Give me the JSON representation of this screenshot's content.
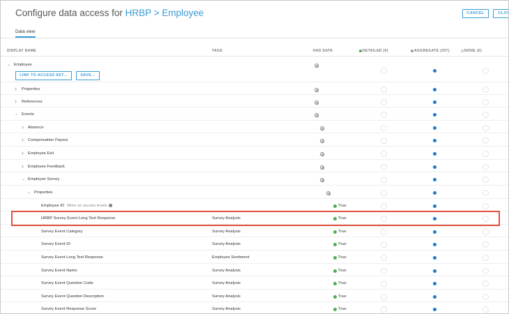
{
  "header": {
    "title_prefix": "Configure data access for ",
    "title_link": "HRBP > Employee",
    "cancel": "CANCEL",
    "close": "CLOSE"
  },
  "tabs": {
    "data_view": "Data view"
  },
  "columns": {
    "display_name": "DISPLAY NAME",
    "tags": "TAGS",
    "has_data": "HAS DATA",
    "detailed": "DETAILED (0)",
    "aggregate": "AGGREGATE (307)",
    "none": "NONE (0)"
  },
  "colors": {
    "accent": "#3a9bd5",
    "selected": "#1f7ac9",
    "true_dot": "#4caf50",
    "highlight": "#e0503c",
    "detailed_dot": "#4caf50",
    "aggregate_dot": "#9e9e9e",
    "none_dot": "#bbbbbb"
  },
  "buttons": {
    "link_to_access_set": "LINK TO ACCESS SET...",
    "save": "SAVE..."
  },
  "rows": [
    {
      "label": "Employee",
      "tag": "",
      "has": "icon",
      "chevron": "down",
      "selected": "aggregate"
    },
    {
      "label": "Properties",
      "tag": "",
      "has": "icon",
      "chevron": "right",
      "selected": "aggregate"
    },
    {
      "label": "References",
      "tag": "",
      "has": "icon",
      "chevron": "right",
      "selected": "aggregate"
    },
    {
      "label": "Events",
      "tag": "",
      "has": "icon",
      "chevron": "down",
      "selected": "aggregate"
    },
    {
      "label": "Absence",
      "tag": "",
      "has": "icon",
      "chevron": "right",
      "selected": "aggregate"
    },
    {
      "label": "Compensation Payout",
      "tag": "",
      "has": "icon",
      "chevron": "right",
      "selected": "aggregate"
    },
    {
      "label": "Employee Exit",
      "tag": "",
      "has": "icon",
      "chevron": "right",
      "selected": "aggregate"
    },
    {
      "label": "Employee Feedback",
      "tag": "",
      "has": "icon",
      "chevron": "right",
      "selected": "aggregate"
    },
    {
      "label": "Employee Survey",
      "tag": "",
      "has": "icon",
      "chevron": "down",
      "selected": "aggregate"
    },
    {
      "label": "Properties",
      "tag": "",
      "has": "icon",
      "chevron": "down",
      "selected": "aggregate"
    },
    {
      "label": "Employee ID",
      "note": "More on access levels",
      "tag": "",
      "has": "True",
      "selected": "aggregate"
    },
    {
      "label": "HRBP Survey Event Long Text Response",
      "tag": "Survey Analysis",
      "has": "True",
      "selected": "aggregate"
    },
    {
      "label": "Survey Event Category",
      "tag": "Survey Analysis",
      "has": "True",
      "selected": "aggregate"
    },
    {
      "label": "Survey Event ID",
      "tag": "Survey Analysis",
      "has": "True",
      "selected": "aggregate"
    },
    {
      "label": "Survey Event Long Text Response",
      "tag": "Employee Sentiment",
      "has": "True",
      "selected": "aggregate"
    },
    {
      "label": "Survey Event Name",
      "tag": "Survey Analysis",
      "has": "True",
      "selected": "aggregate"
    },
    {
      "label": "Survey Event Question Code",
      "tag": "Survey Analysis",
      "has": "True",
      "selected": "aggregate"
    },
    {
      "label": "Survey Event Question Description",
      "tag": "Survey Analysis",
      "has": "True",
      "selected": "aggregate"
    },
    {
      "label": "Survey Event Response Score",
      "tag": "Survey Analysis",
      "has": "True",
      "selected": "aggregate"
    }
  ]
}
